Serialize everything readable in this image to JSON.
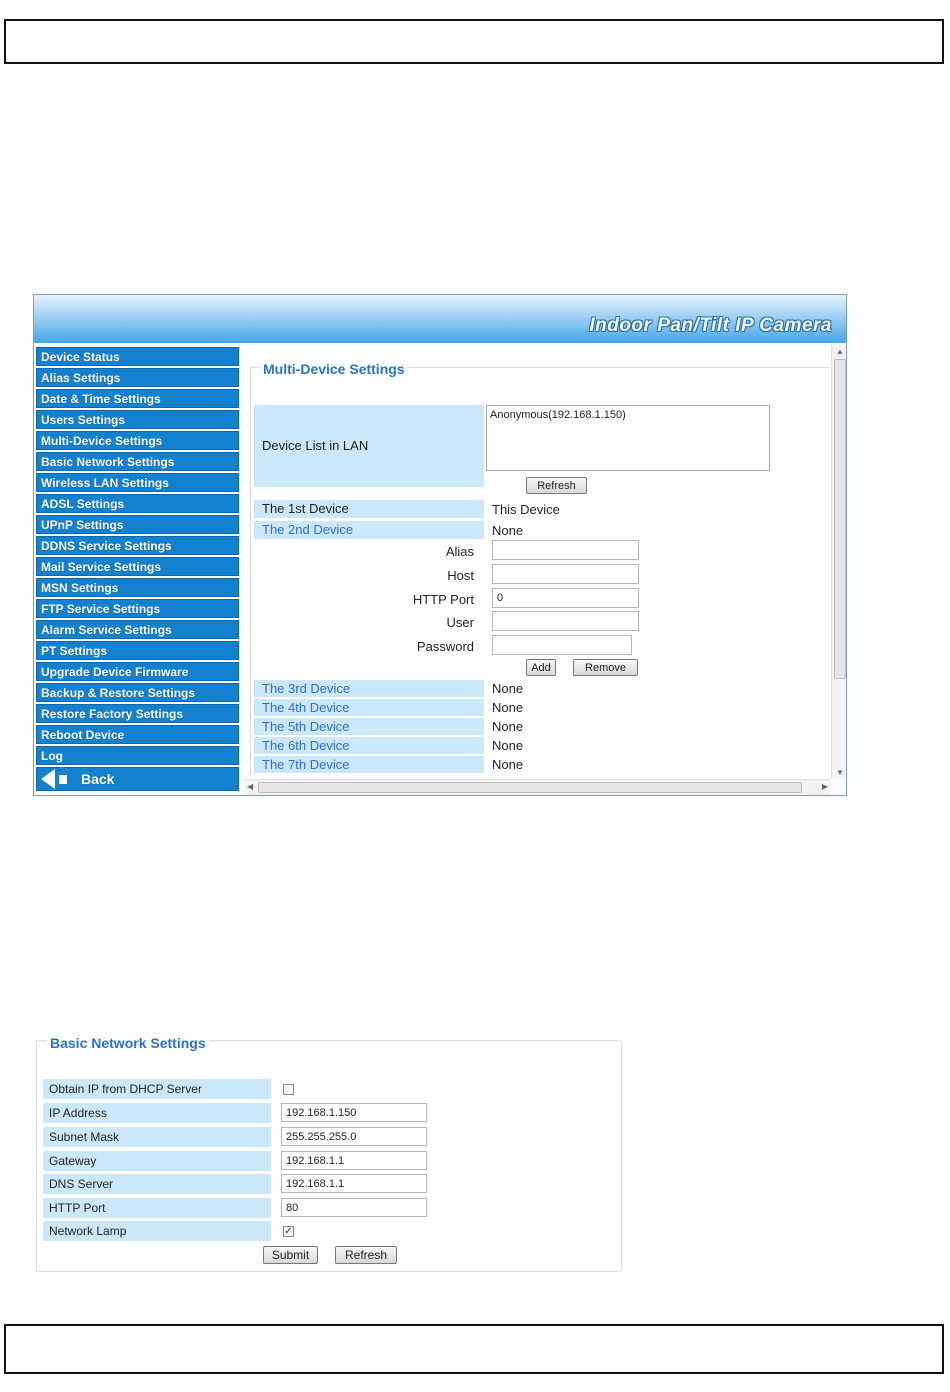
{
  "camera": {
    "title": "Indoor Pan/Tilt IP Camera",
    "sidebar": [
      "Device Status",
      "Alias Settings",
      "Date & Time Settings",
      "Users Settings",
      "Multi-Device Settings",
      "Basic Network Settings",
      "Wireless LAN Settings",
      "ADSL Settings",
      "UPnP Settings",
      "DDNS Service Settings",
      "Mail Service Settings",
      "MSN Settings",
      "FTP Service Settings",
      "Alarm Service Settings",
      "PT Settings",
      "Upgrade Device Firmware",
      "Backup & Restore Settings",
      "Restore Factory Settings",
      "Reboot Device",
      "Log"
    ],
    "back_label": "Back",
    "multi_device": {
      "legend": "Multi-Device Settings",
      "device_list_label": "Device List in LAN",
      "device_list_items": [
        "Anonymous(192.168.1.150)"
      ],
      "refresh_label": "Refresh",
      "first_device_label": "The 1st Device",
      "first_device_value": "This Device",
      "second_device_label": "The 2nd Device",
      "second_device_value": "None",
      "fields": {
        "alias_label": "Alias",
        "alias_value": "",
        "host_label": "Host",
        "host_value": "",
        "http_port_label": "HTTP Port",
        "http_port_value": "0",
        "user_label": "User",
        "user_value": "",
        "password_label": "Password",
        "password_value": ""
      },
      "add_label": "Add",
      "remove_label": "Remove",
      "other_devices": [
        {
          "label": "The 3rd Device",
          "value": "None"
        },
        {
          "label": "The 4th Device",
          "value": "None"
        },
        {
          "label": "The 5th Device",
          "value": "None"
        },
        {
          "label": "The 6th Device",
          "value": "None"
        },
        {
          "label": "The 7th Device",
          "value": "None"
        }
      ]
    }
  },
  "basic_network": {
    "legend": "Basic Network Settings",
    "dhcp_label": "Obtain IP from DHCP Server",
    "dhcp_checked": false,
    "ip_label": "IP Address",
    "ip_value": "192.168.1.150",
    "subnet_label": "Subnet Mask",
    "subnet_value": "255.255.255.0",
    "gateway_label": "Gateway",
    "gateway_value": "192.168.1.1",
    "dns_label": "DNS Server",
    "dns_value": "192.168.1.1",
    "http_port_label": "HTTP Port",
    "http_port_value": "80",
    "lamp_label": "Network Lamp",
    "lamp_checked": true,
    "submit_label": "Submit",
    "refresh_label": "Refresh"
  }
}
